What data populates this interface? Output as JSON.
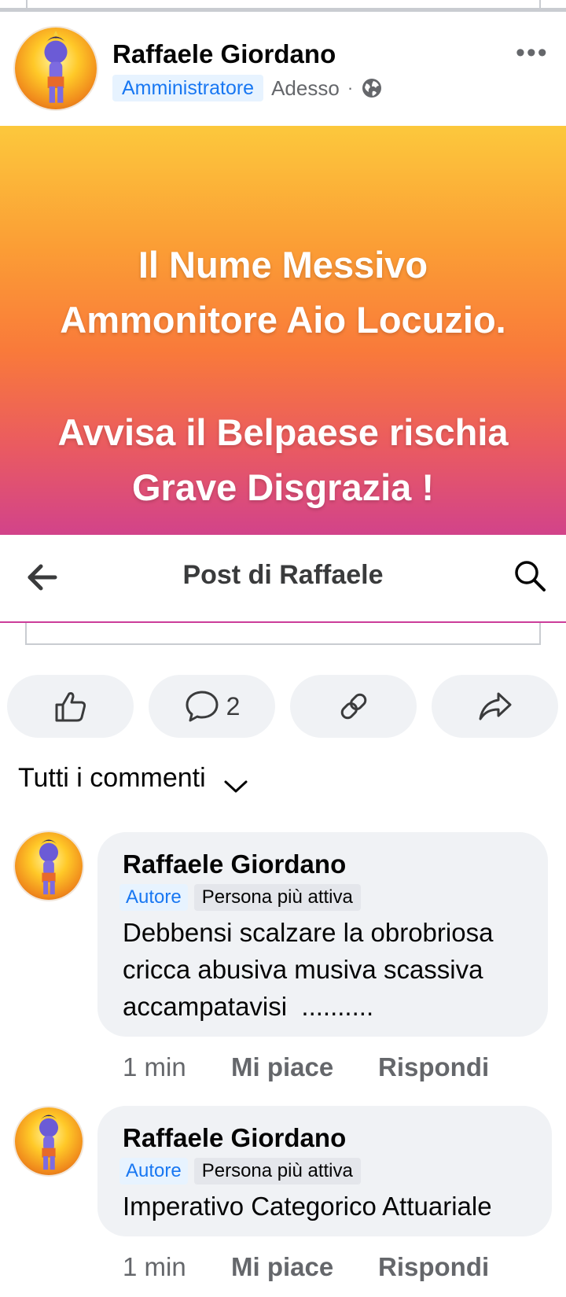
{
  "post": {
    "author": "Raffaele Giordano",
    "role_badge": "Amministratore",
    "time": "Adesso",
    "dot": "·",
    "more_label": "•••",
    "banner_lines": [
      "Il Nume Messivo",
      "Ammonitore Aio Locuzio.",
      "Avvisa il Belpaese rischia",
      "Grave Disgrazia !"
    ]
  },
  "nav": {
    "title": "Post di Raffaele"
  },
  "actions": {
    "comment_count": "2"
  },
  "comments_filter": {
    "label": "Tutti i commenti"
  },
  "comments": [
    {
      "author": "Raffaele Giordano",
      "badge_author": "Autore",
      "badge_active": "Persona più attiva",
      "lines": [
        "Debbensi scalzare la obrobriosa",
        "cricca abusiva musiva scassiva",
        "accampatavisi  .........."
      ],
      "time": "1 min",
      "like": "Mi piace",
      "reply": "Rispondi"
    },
    {
      "author": "Raffaele Giordano",
      "badge_author": "Autore",
      "badge_active": "Persona più attiva",
      "lines": [
        "Imperativo Categorico Attuariale"
      ],
      "time": "1 min",
      "like": "Mi piace",
      "reply": "Rispondi"
    }
  ],
  "colors": {
    "accent_blue": "#1877f2",
    "badge_bg": "#e7f3ff",
    "bubble_bg": "#f0f2f5",
    "muted_text": "#65676b",
    "nav_divider": "#cc3d9a"
  },
  "icons": [
    "back-arrow-icon",
    "search-icon",
    "globe-icon",
    "like-icon",
    "comment-icon",
    "link-icon",
    "share-icon",
    "chevron-down-icon",
    "more-options-icon"
  ]
}
